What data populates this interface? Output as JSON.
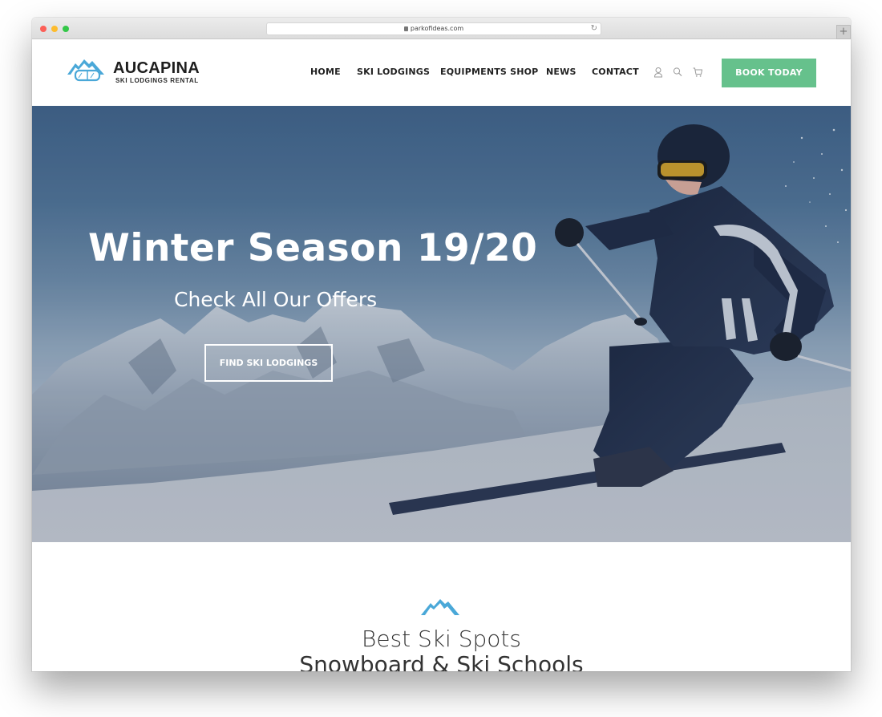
{
  "browser": {
    "url": "parkofideas.com",
    "new_tab_label": "+"
  },
  "header": {
    "logo": {
      "title": "AUCAPINA",
      "subtitle": "SKI LODGINGS RENTAL"
    },
    "nav": [
      {
        "label": "HOME"
      },
      {
        "label": "SKI LODGINGS"
      },
      {
        "label": "EQUIPMENTS SHOP"
      },
      {
        "label": "NEWS"
      },
      {
        "label": "CONTACT"
      }
    ],
    "icons": [
      "user-icon",
      "search-icon",
      "cart-icon"
    ],
    "cta_label": "BOOK TODAY",
    "cta_color": "#66c18c"
  },
  "hero": {
    "title": "Winter Season 19/20",
    "subtitle": "Check All Our Offers",
    "button_label": "FIND SKI LODGINGS"
  },
  "section": {
    "title": "Best Ski Spots",
    "subtitle": "Snowboard & Ski Schools",
    "accent_color": "#4aa8d8"
  }
}
